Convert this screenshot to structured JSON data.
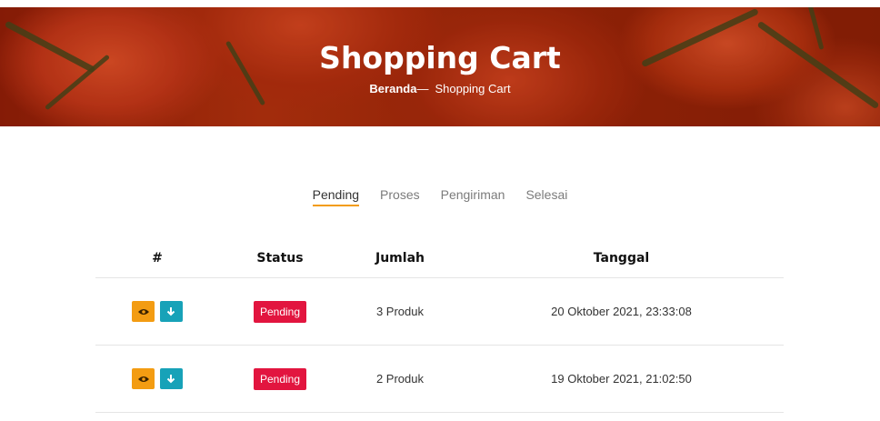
{
  "hero": {
    "title": "Shopping Cart",
    "breadcrumb_home": "Beranda",
    "breadcrumb_sep": "—",
    "breadcrumb_current": "Shopping Cart"
  },
  "tabs": [
    {
      "label": "Pending",
      "active": true
    },
    {
      "label": "Proses",
      "active": false
    },
    {
      "label": "Pengiriman",
      "active": false
    },
    {
      "label": "Selesai",
      "active": false
    }
  ],
  "table": {
    "headers": [
      "#",
      "Status",
      "Jumlah",
      "Tanggal"
    ],
    "rows": [
      {
        "status": "Pending",
        "jumlah": "3 Produk",
        "tanggal": "20 Oktober 2021, 23:33:08"
      },
      {
        "status": "Pending",
        "jumlah": "2 Produk",
        "tanggal": "19 Oktober 2021, 21:02:50"
      }
    ]
  },
  "icons": {
    "view": "eye-icon",
    "download": "arrow-down-icon"
  },
  "colors": {
    "accent": "#f39c12",
    "view_button": "#f39c12",
    "download_button": "#17a2b8",
    "badge_pending": "#e2153f"
  }
}
